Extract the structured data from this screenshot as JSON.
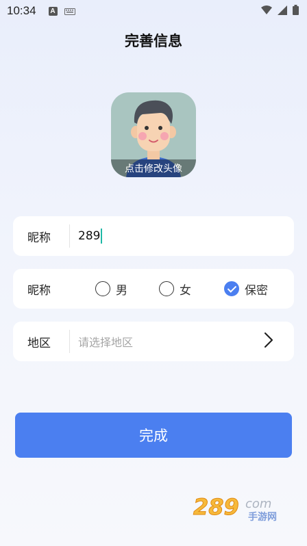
{
  "status_bar": {
    "time": "10:34",
    "a_icon": "A"
  },
  "page": {
    "title": "完善信息"
  },
  "avatar": {
    "caption": "点击修改头像"
  },
  "nickname": {
    "label": "昵称",
    "value": "289"
  },
  "gender": {
    "label": "昵称",
    "options": [
      {
        "label": "男",
        "selected": false
      },
      {
        "label": "女",
        "selected": false
      },
      {
        "label": "保密",
        "selected": true
      }
    ]
  },
  "region": {
    "label": "地区",
    "placeholder": "请选择地区"
  },
  "submit": {
    "label": "完成"
  },
  "colors": {
    "accent": "#4b7ff0",
    "cursor": "#1fb8a6",
    "card": "#ffffff"
  },
  "watermark": {
    "brand": "289",
    "suffix": "com",
    "subtitle": "手游网"
  }
}
